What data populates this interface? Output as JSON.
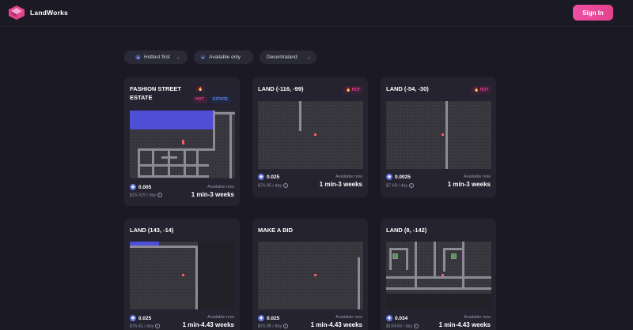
{
  "header": {
    "brand": "LandWorks",
    "signin_label": "Sign In"
  },
  "filters": {
    "sort": "Hottest first",
    "availability": "Available only",
    "metaverse": "Decentraland"
  },
  "colors": {
    "accent": "#e2448f",
    "eth": "#6076dc",
    "hot": "#ee3f9b",
    "estate": "#5f7ff0"
  },
  "cards": [
    {
      "title": "FASHION STREET ESTATE",
      "badges": [
        "HOT",
        "ESTATE"
      ],
      "price": "0.005",
      "per_day": "$15.319 / day",
      "available": "Available now",
      "period": "1 min-3 weeks"
    },
    {
      "title": "LAND (-116, -99)",
      "badges": [
        "HOT"
      ],
      "price": "0.025",
      "per_day": "$76.95 / day",
      "available": "Available now",
      "period": "1 min-3 weeks"
    },
    {
      "title": "LAND (-54, -30)",
      "badges": [
        "HOT"
      ],
      "price": "0.0025",
      "per_day": "$7.69 / day",
      "available": "Available now",
      "period": "1 min-3 weeks"
    },
    {
      "title": "LAND (143, -14)",
      "badges": [],
      "price": "0.025",
      "per_day": "$76.41 / day",
      "available": "Available now",
      "period": "1 min-4.43 weeks"
    },
    {
      "title": "MAKE A BID",
      "badges": [],
      "price": "0.025",
      "per_day": "$76.95 / day",
      "available": "Available now",
      "period": "1 min-4.43 weeks"
    },
    {
      "title": "LAND (8, -142)",
      "badges": [],
      "price": "0.034",
      "per_day": "$104.65 / day",
      "available": "Available now",
      "period": "1 min-4.43 weeks"
    }
  ]
}
